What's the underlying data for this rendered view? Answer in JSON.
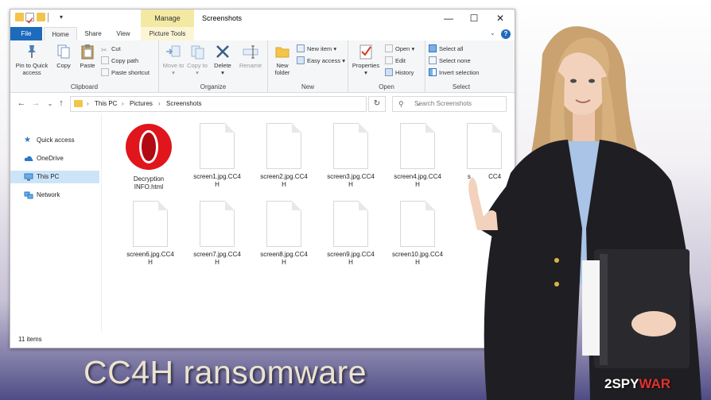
{
  "window": {
    "title": "Screenshots",
    "context_tab": "Manage",
    "minimize": "—",
    "maximize": "☐",
    "close": "✕"
  },
  "tabs": {
    "file": "File",
    "home": "Home",
    "share": "Share",
    "view": "View",
    "picture_tools": "Picture Tools"
  },
  "ribbon": {
    "clipboard": {
      "label": "Clipboard",
      "pin": "Pin to Quick access",
      "copy": "Copy",
      "paste": "Paste",
      "cut": "Cut",
      "copy_path": "Copy path",
      "paste_shortcut": "Paste shortcut"
    },
    "organize": {
      "label": "Organize",
      "move_to": "Move to",
      "copy_to": "Copy to",
      "delete": "Delete",
      "rename": "Rename"
    },
    "new": {
      "label": "New",
      "new_folder": "New folder",
      "new_item": "New item",
      "easy_access": "Easy access"
    },
    "open": {
      "label": "Open",
      "properties": "Properties",
      "open": "Open",
      "edit": "Edit",
      "history": "History"
    },
    "select": {
      "label": "Select",
      "select_all": "Select all",
      "select_none": "Select none",
      "invert_selection": "Invert selection"
    }
  },
  "address": {
    "path": [
      "This PC",
      "Pictures",
      "Screenshots"
    ],
    "search_placeholder": "Search Screenshots"
  },
  "nav": {
    "items": [
      {
        "label": "Quick access"
      },
      {
        "label": "OneDrive"
      },
      {
        "label": "This PC"
      },
      {
        "label": "Network"
      }
    ]
  },
  "files": [
    {
      "line1": "Decryption",
      "line2": "INFO.html"
    },
    {
      "line1": "screen1.jpg.CC4",
      "line2": "H"
    },
    {
      "line1": "screen2.jpg.CC4",
      "line2": "H"
    },
    {
      "line1": "screen3.jpg.CC4",
      "line2": "H"
    },
    {
      "line1": "screen4.jpg.CC4",
      "line2": "H"
    },
    {
      "line1": "s",
      "line2": "CC4"
    },
    {
      "line1": "screen6.jpg.CC4",
      "line2": "H"
    },
    {
      "line1": "screen7.jpg.CC4",
      "line2": "H"
    },
    {
      "line1": "screen8.jpg.CC4",
      "line2": "H"
    },
    {
      "line1": "screen9.jpg.CC4",
      "line2": "H"
    },
    {
      "line1": "screen10.jpg.CC4",
      "line2": "H"
    }
  ],
  "status": {
    "count": "11 items"
  },
  "caption": "CC4H ransomware",
  "logo": {
    "two": "2",
    "spy": "SPY",
    "war": "WAR"
  },
  "colors": {
    "file_tab": "#1e6bbd",
    "manage_tab": "#f3e9a3",
    "selection": "#cce4f7",
    "caption": "#ece3d0",
    "opera_red": "#e1151c"
  }
}
